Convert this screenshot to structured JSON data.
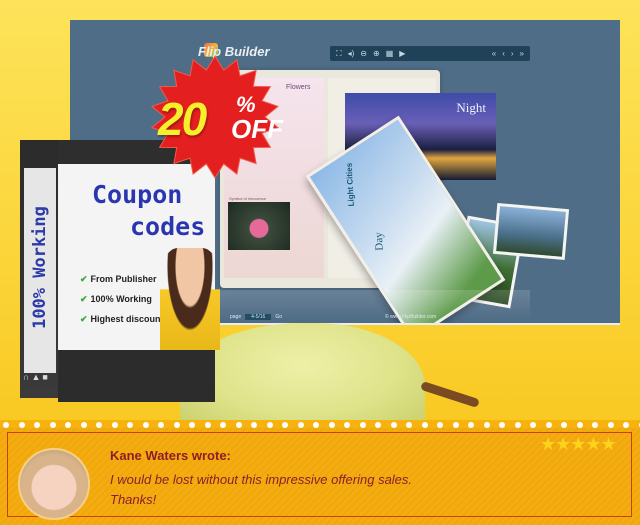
{
  "promo": {
    "discount_value": "20",
    "discount_symbol": "%",
    "discount_suffix": "OFF"
  },
  "app_screenshot": {
    "logo_text": "Flip Builder",
    "toolbar_left_icons": [
      "fullscreen-icon",
      "sound-icon",
      "zoom-out-icon",
      "zoom-in-icon",
      "thumbnails-icon",
      "play-icon"
    ],
    "toolbar_right_icons": [
      "first-page-icon",
      "prev-page-icon",
      "next-page-icon",
      "last-page-icon"
    ],
    "left_page_title": "Flowers",
    "left_page_caption": "Symbol of innocence",
    "flip_page_title": "Light Cities",
    "flip_page_label": "Day",
    "right_page_label": "Night",
    "goto_label": "Go",
    "goto_prefix": "page",
    "page_indicator": "4-5/16",
    "copyright": "© www.FlipBuilder.com"
  },
  "product_box": {
    "side_text": "100% Working",
    "title_line1": "Coupon",
    "title_line2": "codes",
    "features": [
      "From Publisher",
      "100% Working",
      "Highest discount"
    ],
    "bottom_icons": [
      "headset-icon",
      "user-icon",
      "chat-icon"
    ]
  },
  "review": {
    "author": "Kane Waters wrote:",
    "text_line1": "I would be lost without this impressive offering sales.",
    "text_line2": "Thanks!",
    "rating": 5,
    "rating_max": 5,
    "stars": "★★★★★"
  },
  "colors": {
    "background_yellow": "#fbd94a",
    "review_orange": "#f3ad10",
    "review_text": "#8b1e2a",
    "badge_red": "#e41f1f",
    "badge_yellow_text": "#f5f02a",
    "box_title_blue": "#2a36b0",
    "screenshot_bg": "#506d87"
  }
}
